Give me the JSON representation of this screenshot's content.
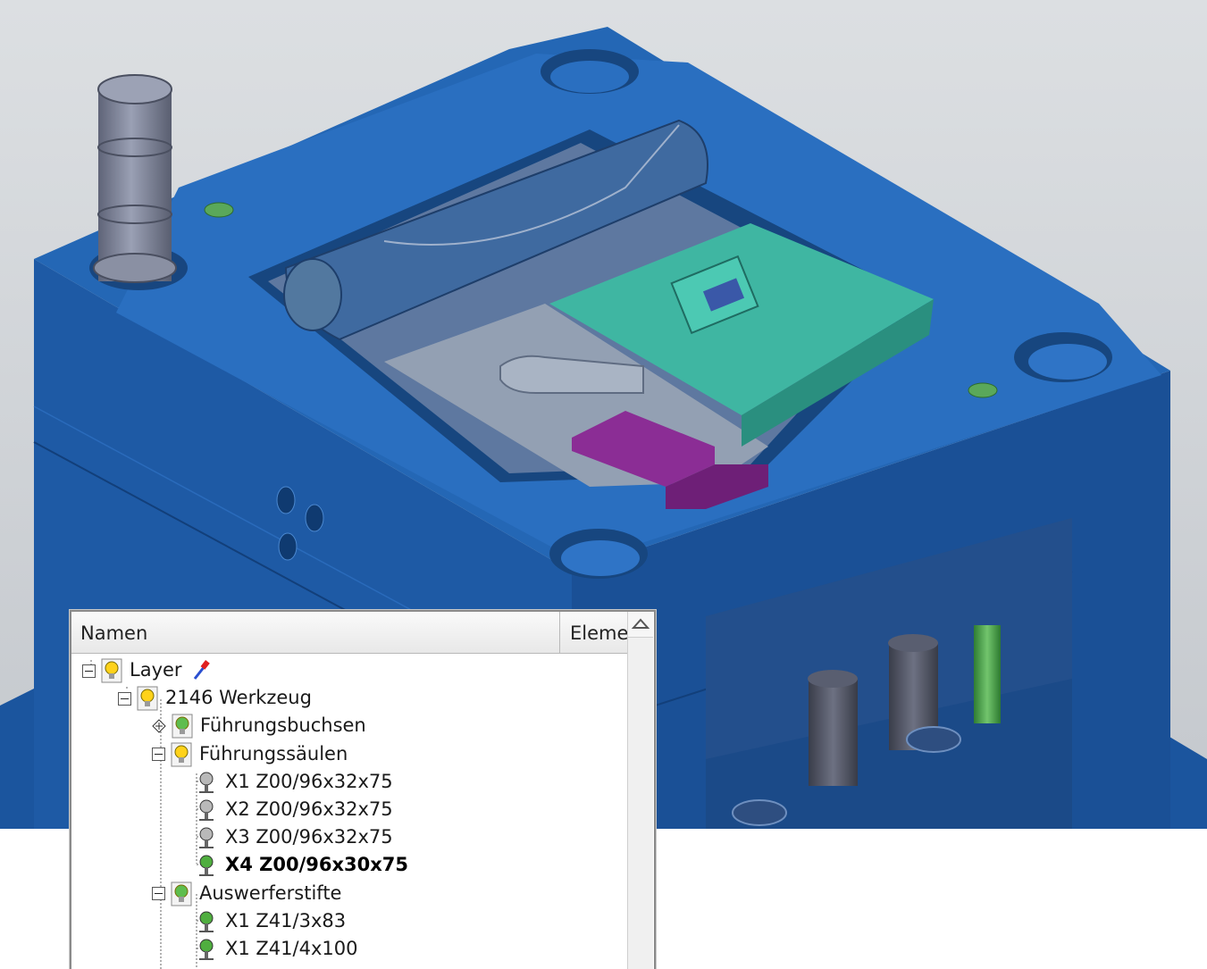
{
  "viewport": {
    "colors": {
      "background_top": "#d9dcdf",
      "background_bottom": "#c9cdd1",
      "mold_blue": "#1f5ca8",
      "mold_blue_dark": "#174a8c",
      "mold_blue_light": "#2f74c6",
      "cavity_gray": "#6f86a4",
      "insert_teal": "#3fb6a2",
      "slider_purple": "#8b2d95",
      "pillar_gray": "#7a7f93",
      "pin_green": "#5aa85a"
    }
  },
  "layer_panel": {
    "columns": [
      "Namen",
      "Eleme"
    ],
    "tree": [
      {
        "label": "Layer",
        "level": 0,
        "toggle": "collapse",
        "icon": "bulb-yellow-icon",
        "extra_icon": "pipette-icon",
        "bold": false
      },
      {
        "label": "2146 Werkzeug",
        "level": 1,
        "toggle": "collapse",
        "icon": "bulb-yellow-icon",
        "bold": false
      },
      {
        "label": "Führungsbuchsen",
        "level": 2,
        "toggle": "expand",
        "icon": "bulb-green-icon",
        "bold": false
      },
      {
        "label": "Führungssäulen",
        "level": 2,
        "toggle": "collapse",
        "icon": "bulb-yellow-icon",
        "bold": false
      },
      {
        "label": "X1 Z00/96x32x75",
        "level": 3,
        "toggle": "none",
        "icon": "pin-gray-icon",
        "bold": false
      },
      {
        "label": "X2 Z00/96x32x75",
        "level": 3,
        "toggle": "none",
        "icon": "pin-gray-icon",
        "bold": false
      },
      {
        "label": "X3 Z00/96x32x75",
        "level": 3,
        "toggle": "none",
        "icon": "pin-gray-icon",
        "bold": false
      },
      {
        "label": "X4 Z00/96x30x75",
        "level": 3,
        "toggle": "none",
        "icon": "pin-green-icon",
        "bold": true
      },
      {
        "label": "Auswerferstifte",
        "level": 2,
        "toggle": "collapse",
        "icon": "bulb-green-icon",
        "bold": false
      },
      {
        "label": "X1 Z41/3x83",
        "level": 3,
        "toggle": "none",
        "icon": "pin-green-icon",
        "bold": false
      },
      {
        "label": "X1 Z41/4x100",
        "level": 3,
        "toggle": "none",
        "icon": "pin-green-icon",
        "bold": false
      }
    ]
  }
}
